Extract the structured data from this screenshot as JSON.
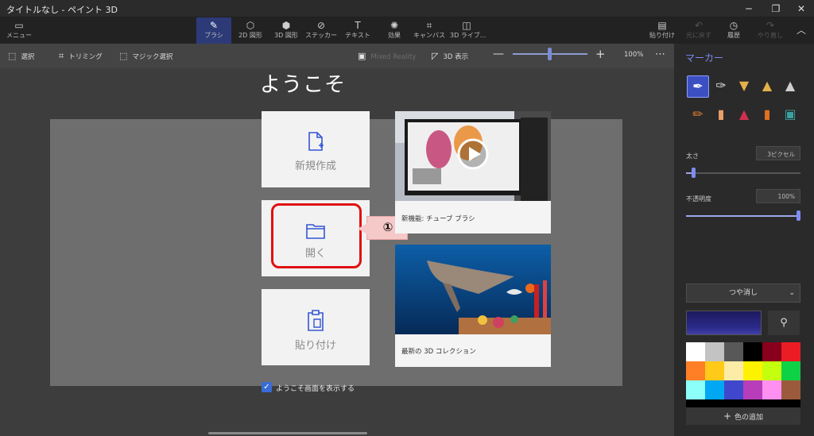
{
  "window": {
    "title": "タイトルなし - ペイント 3D",
    "min": "─",
    "max": "❐",
    "close": "✕"
  },
  "toolbar": {
    "menu": {
      "icon": "▭",
      "label": "メニュー"
    },
    "tabs": [
      {
        "icon": "✎",
        "label": "ブラシ"
      },
      {
        "icon": "⬡",
        "label": "2D 図形"
      },
      {
        "icon": "⬢",
        "label": "3D 図形"
      },
      {
        "icon": "⊘",
        "label": "ステッカー"
      },
      {
        "icon": "T",
        "label": "テキスト"
      },
      {
        "icon": "✺",
        "label": "効果"
      },
      {
        "icon": "⌗",
        "label": "キャンバス"
      },
      {
        "icon": "◫",
        "label": "3D ライブ..."
      }
    ],
    "paste": {
      "icon": "▤",
      "label": "貼り付け"
    },
    "undo": {
      "icon": "↶",
      "label": "元に戻す"
    },
    "history": {
      "icon": "◷",
      "label": "履歴"
    },
    "redo": {
      "icon": "↷",
      "label": "やり直し"
    },
    "collapse": "︿"
  },
  "subbar": {
    "select": "選択",
    "trim": "トリミング",
    "magic": "マジック選択",
    "mixed_reality": "Mixed Reality",
    "view3d": "3D 表示",
    "zoom_minus": "—",
    "zoom_plus": "+",
    "zoom": "100%",
    "more": "⋯"
  },
  "panel": {
    "title": "マーカー",
    "size_label": "太さ",
    "size_value": "3ピクセル",
    "opacity_label": "不透明度",
    "opacity_value": "100%",
    "finish": "つや消し",
    "finish_chevron": "⌄",
    "eyedropper": "⚲",
    "add_color": "色の追加",
    "add_plus": "+",
    "swatches": [
      "#ffffff",
      "#c3c3c3",
      "#585858",
      "#000000",
      "#88001b",
      "#ec1c24",
      "#ff7f27",
      "#ffca18",
      "#fdeca6",
      "#fff200",
      "#c4ff0e",
      "#0ed145",
      "#8cfffb",
      "#00a8f3",
      "#3f48cc",
      "#b83dba",
      "#ff8ff0",
      "#9c5a3c",
      "#000000",
      "#000000",
      "#000000",
      "#000000",
      "#000000",
      "#000000"
    ]
  },
  "welcome": {
    "title": "ようこそ",
    "new": "新規作成",
    "open": "開く",
    "paste": "貼り付け",
    "callout": "①",
    "video_caption": "新機能: チューブ ブラシ",
    "collection_caption": "最新の 3D コレクション",
    "show_check": "✓",
    "show_label": "ようこそ画面を表示する"
  },
  "colors": {
    "accent": "#3c4fc2",
    "highlight": "#e01010"
  }
}
